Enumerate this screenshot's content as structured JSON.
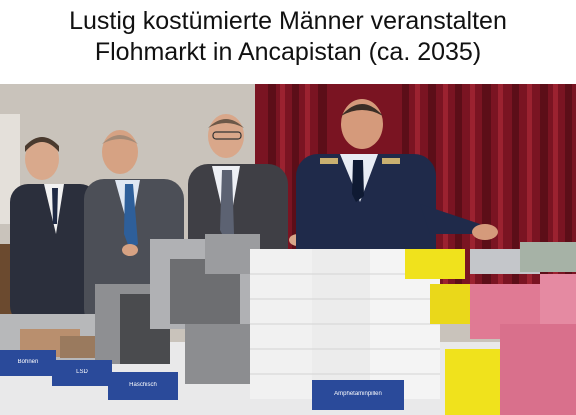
{
  "caption": {
    "line1": "Lustig kostümierte Männer veranstalten",
    "line2": "Flohmarkt in Ancapistan (ca. 2035)"
  },
  "photo": {
    "signs": [
      {
        "id": "sign-1",
        "text": "Bohnen"
      },
      {
        "id": "sign-2",
        "text": "LSD"
      },
      {
        "id": "sign-3",
        "text": "Haschisch"
      },
      {
        "id": "sign-4",
        "text": "Amphetaminpillen"
      }
    ],
    "colors": {
      "curtain": "#7a1422",
      "wall": "#c9c3bb",
      "table": "#e9e9ea",
      "yellow_pills": "#f0e21c",
      "pink_pills": "#e07a94",
      "sign_blue": "#2a4a9a"
    }
  }
}
